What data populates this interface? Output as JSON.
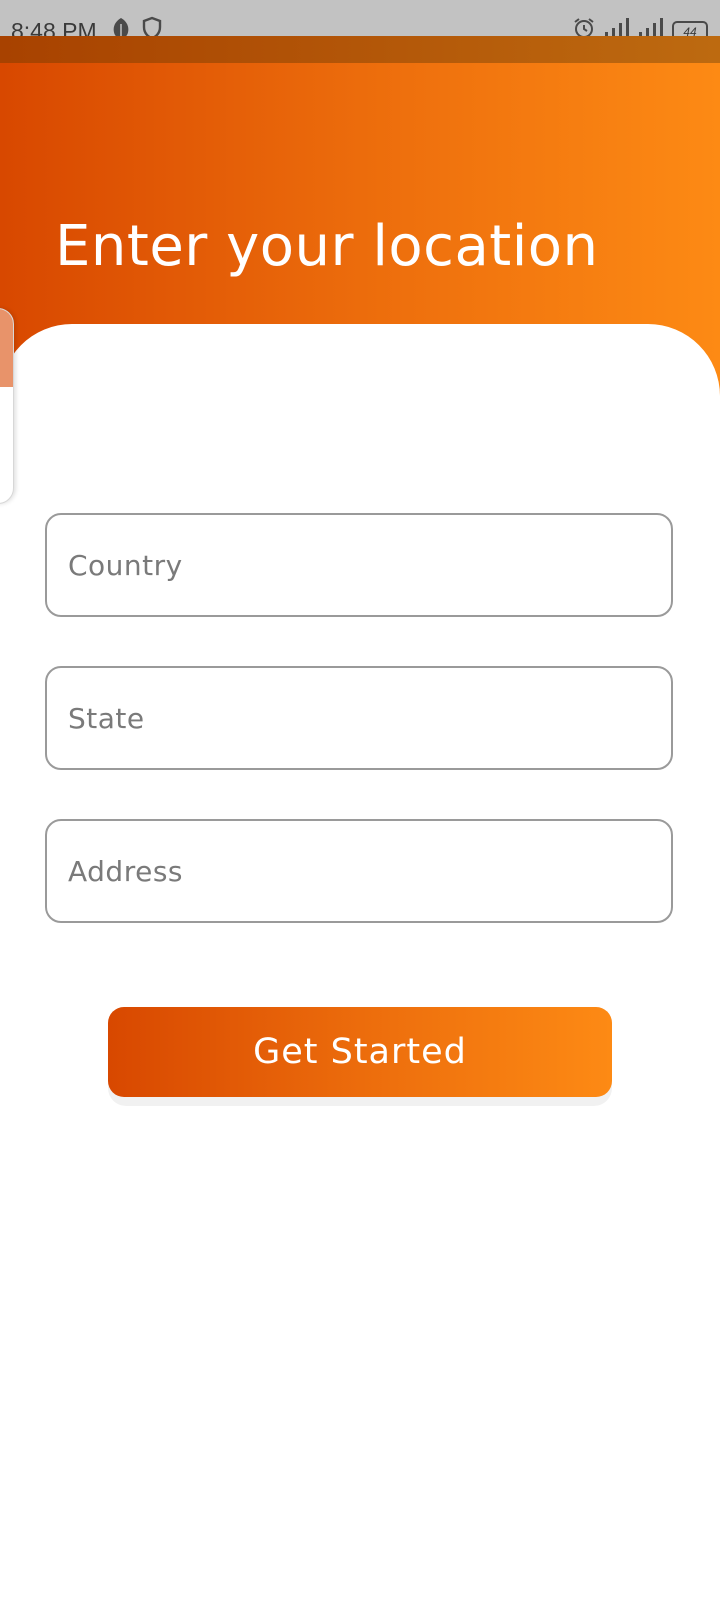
{
  "status_bar": {
    "time": "8:48 PM",
    "battery": "44",
    "left_icons": [
      "leaf-icon",
      "shield-icon"
    ],
    "right_icons": [
      "alarm-icon",
      "signal-icon",
      "signal-icon",
      "battery-icon"
    ]
  },
  "header": {
    "title": "Enter your location"
  },
  "form": {
    "country_placeholder": "Country",
    "state_placeholder": "State",
    "address_placeholder": "Address",
    "submit_label": "Get Started"
  },
  "colors": {
    "gradient_start": "#d84800",
    "gradient_end": "#fd8a14",
    "field_border": "#9a9a9a",
    "placeholder": "#7a7a7a"
  }
}
